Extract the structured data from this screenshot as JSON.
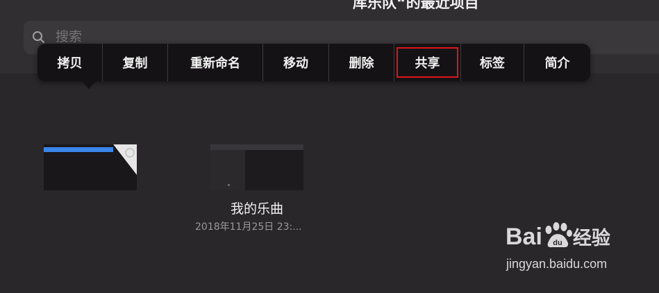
{
  "header": {
    "title": "库乐队“的最近项目",
    "search": {
      "placeholder": "搜索"
    }
  },
  "context_menu": {
    "items": [
      {
        "label": "拷贝"
      },
      {
        "label": "复制"
      },
      {
        "label": "重新命名"
      },
      {
        "label": "移动"
      },
      {
        "label": "删除"
      },
      {
        "label": "共享",
        "highlighted": true
      },
      {
        "label": "标签"
      },
      {
        "label": "简介"
      }
    ],
    "highlight_color": "#e0141a"
  },
  "files": [
    {
      "name": "",
      "date": "",
      "selected": true
    },
    {
      "name": "我的乐曲",
      "date": "2018年11月25日 23:..."
    }
  ],
  "watermark": {
    "logo_left": "Bai",
    "logo_right": "经验",
    "url": "jingyan.baidu.com"
  },
  "colors": {
    "background": "#2a272b",
    "menu_background": "#141214",
    "accent_blue": "#3a86ea"
  }
}
